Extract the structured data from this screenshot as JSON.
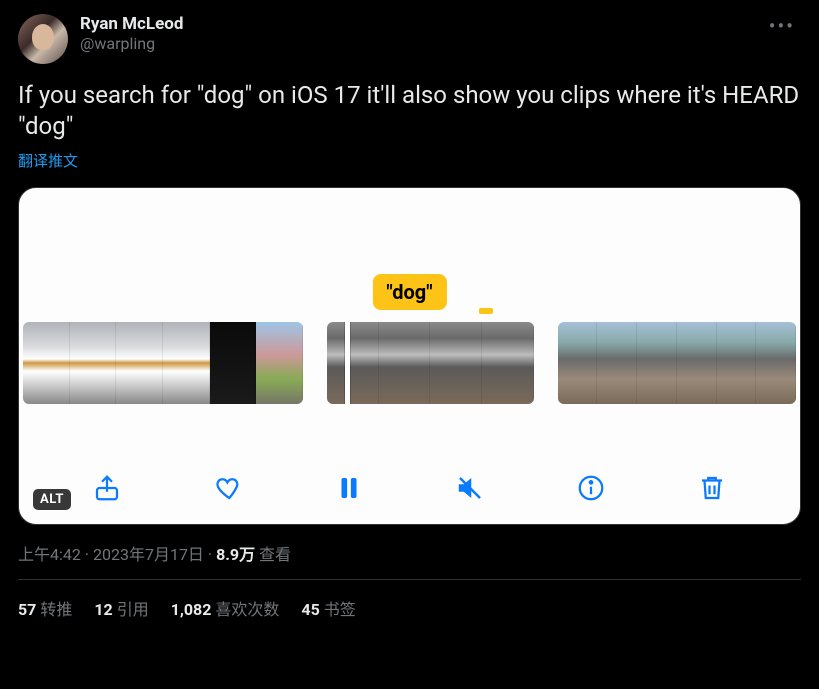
{
  "author": {
    "display_name": "Ryan McLeod",
    "handle": "@warpling"
  },
  "tweet_text": "If you search for \"dog\" on iOS 17 it'll also show you clips where it's HEARD \"dog\"",
  "translate_label": "翻译推文",
  "media": {
    "search_token": "\"dog\"",
    "alt_badge": "ALT",
    "toolbar_icons": [
      "share",
      "heart",
      "pause",
      "mute",
      "info",
      "trash"
    ]
  },
  "meta": {
    "time": "上午4:42",
    "date": "2023年7月17日",
    "views_count": "8.9万",
    "views_label": "查看"
  },
  "stats": {
    "retweets": {
      "count": "57",
      "label": "转推"
    },
    "quotes": {
      "count": "12",
      "label": "引用"
    },
    "likes": {
      "count": "1,082",
      "label": "喜欢次数"
    },
    "bookmarks": {
      "count": "45",
      "label": "书签"
    }
  }
}
